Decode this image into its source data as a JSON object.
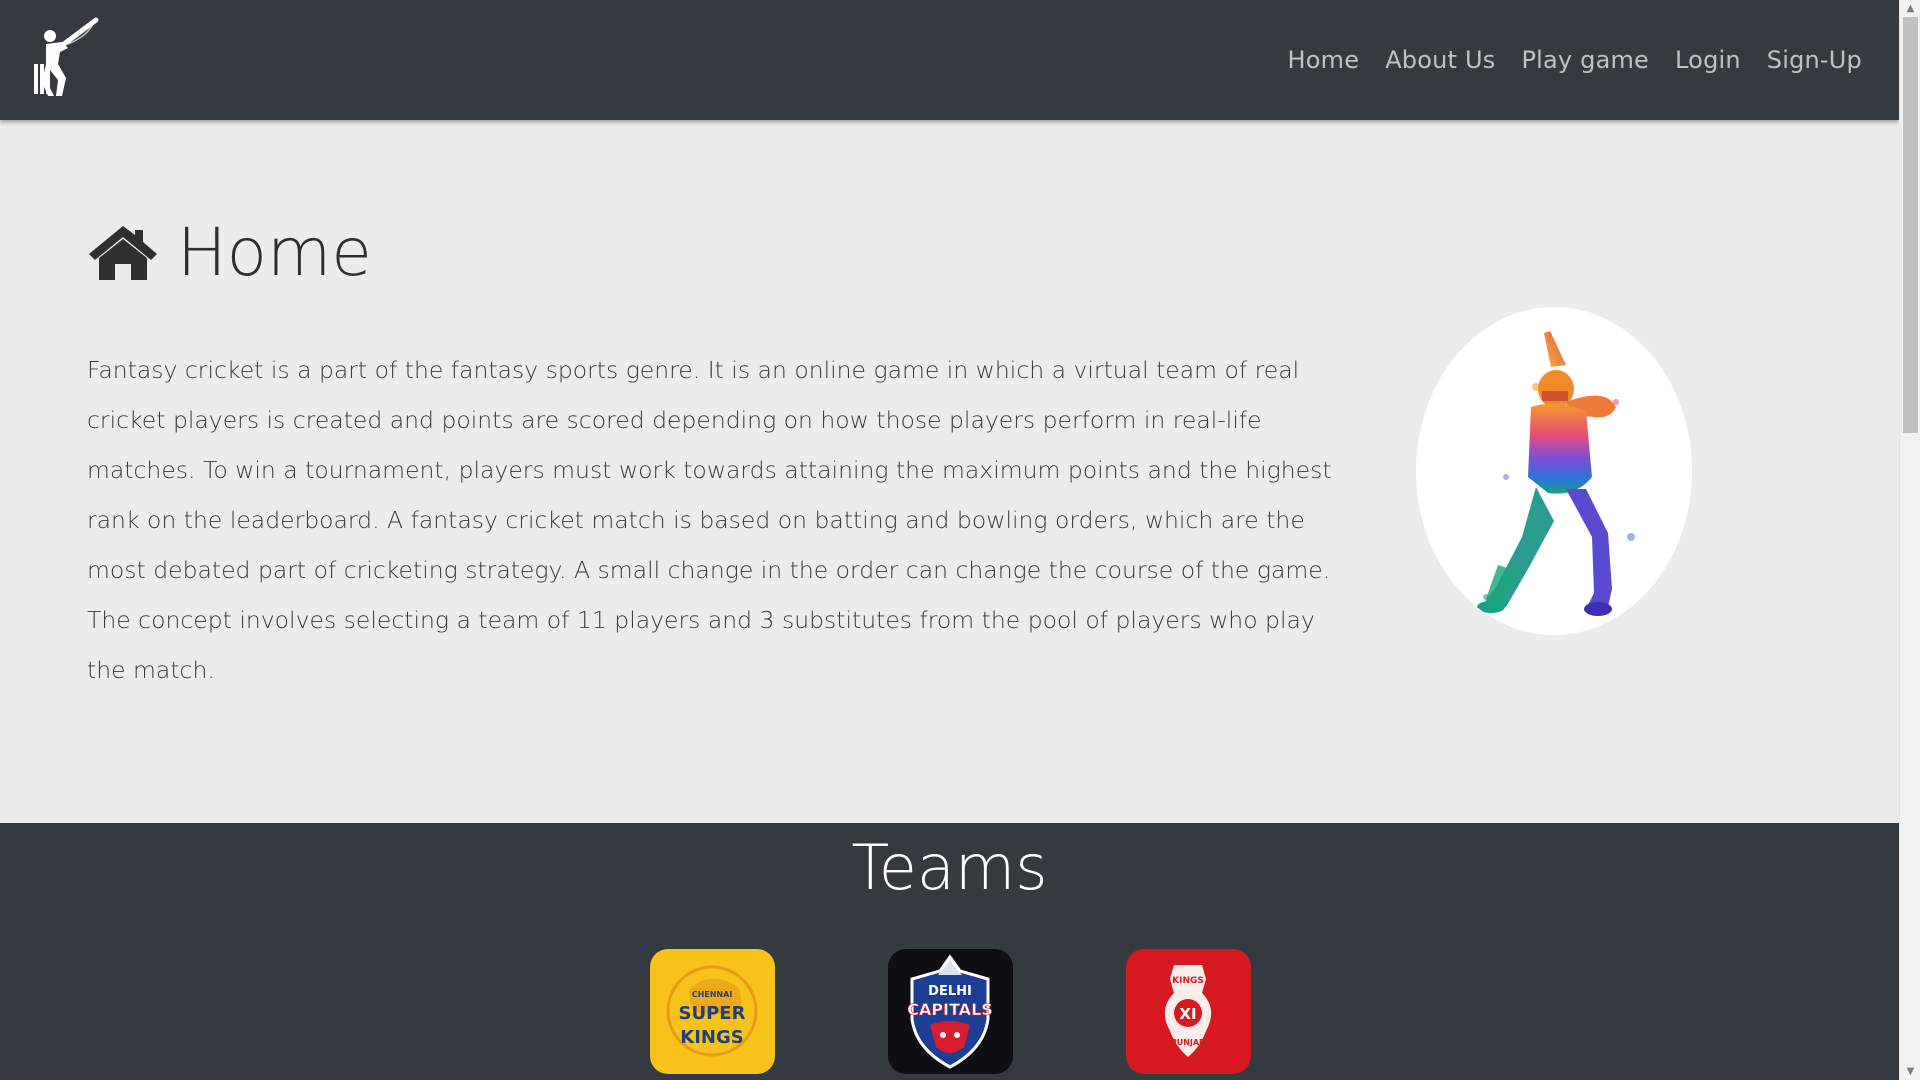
{
  "navbar": {
    "logo_icon": "cricket-batsman-icon",
    "links": [
      {
        "label": "Home"
      },
      {
        "label": "About Us"
      },
      {
        "label": "Play game"
      },
      {
        "label": "Login"
      },
      {
        "label": "Sign-Up"
      }
    ],
    "background": "#343a40",
    "link_color": "#bfc1c3"
  },
  "home": {
    "icon": "house-icon",
    "title": "Home",
    "paragraph": "Fantasy cricket is a part of the fantasy sports genre. It is an online game in which a virtual team of real cricket players is created and points are scored depending on how those players perform in real-life matches. To win a tournament, players must work towards attaining the maximum points and the highest rank on the leaderboard. A fantasy cricket match is based on batting and bowling orders, which are the most debated part of cricketing strategy. A small change in the order can change the course of the game. The concept involves selecting a team of 11 players and 3 substitutes from the pool of players who play the match.",
    "hero_image": "watercolor-batsman-illustration"
  },
  "teams": {
    "title": "Teams",
    "logos": [
      {
        "name": "chennai-super-kings-logo",
        "text_lines": [
          "CHENNAI",
          "SUPER",
          "KINGS"
        ],
        "color": "#f7c31a"
      },
      {
        "name": "delhi-capitals-logo",
        "text_lines": [
          "DELHI",
          "CAPITALS"
        ],
        "color": "#0e0e14"
      },
      {
        "name": "kings-xi-punjab-logo",
        "text_lines": [
          "KINGS",
          "XI",
          "PUNJAB"
        ],
        "color": "#d71920"
      }
    ]
  }
}
